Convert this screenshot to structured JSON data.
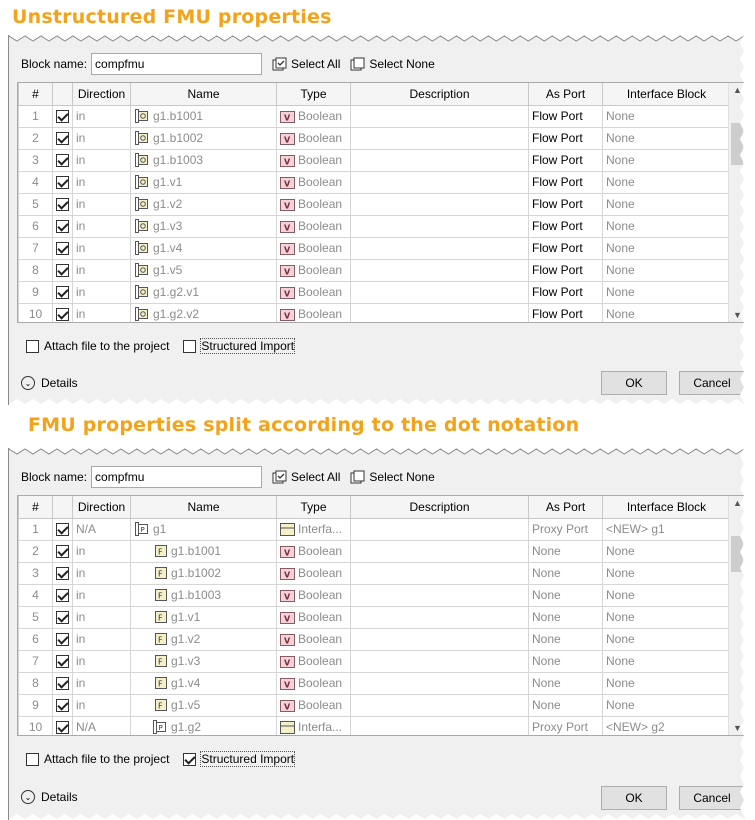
{
  "headings": {
    "first": "Unstructured FMU properties",
    "second": "FMU properties split according to the dot notation"
  },
  "common": {
    "block_name_label": "Block name:",
    "select_all": "Select All",
    "select_none": "Select None",
    "attach_label": "Attach file to the project",
    "structured_label": "Structured Import",
    "details_label": "Details",
    "ok_label": "OK",
    "cancel_label": "Cancel",
    "columns": [
      "#",
      "",
      "Direction",
      "Name",
      "Type",
      "Description",
      "As Port",
      "Interface Block"
    ]
  },
  "dialog1": {
    "block_name": "compfmu",
    "structured_checked": false,
    "rows": [
      {
        "num": "1",
        "direction": "in",
        "name": "g1.b1001",
        "type": "Boolean",
        "as_port": "Flow Port",
        "iface": "None"
      },
      {
        "num": "2",
        "direction": "in",
        "name": "g1.b1002",
        "type": "Boolean",
        "as_port": "Flow Port",
        "iface": "None"
      },
      {
        "num": "3",
        "direction": "in",
        "name": "g1.b1003",
        "type": "Boolean",
        "as_port": "Flow Port",
        "iface": "None"
      },
      {
        "num": "4",
        "direction": "in",
        "name": "g1.v1",
        "type": "Boolean",
        "as_port": "Flow Port",
        "iface": "None"
      },
      {
        "num": "5",
        "direction": "in",
        "name": "g1.v2",
        "type": "Boolean",
        "as_port": "Flow Port",
        "iface": "None"
      },
      {
        "num": "6",
        "direction": "in",
        "name": "g1.v3",
        "type": "Boolean",
        "as_port": "Flow Port",
        "iface": "None"
      },
      {
        "num": "7",
        "direction": "in",
        "name": "g1.v4",
        "type": "Boolean",
        "as_port": "Flow Port",
        "iface": "None"
      },
      {
        "num": "8",
        "direction": "in",
        "name": "g1.v5",
        "type": "Boolean",
        "as_port": "Flow Port",
        "iface": "None"
      },
      {
        "num": "9",
        "direction": "in",
        "name": "g1.g2.v1",
        "type": "Boolean",
        "as_port": "Flow Port",
        "iface": "None"
      },
      {
        "num": "10",
        "direction": "in",
        "name": "g1.g2.v2",
        "type": "Boolean",
        "as_port": "Flow Port",
        "iface": "None"
      }
    ]
  },
  "dialog2": {
    "block_name": "compfmu",
    "structured_checked": true,
    "rows": [
      {
        "num": "1",
        "direction": "N/A",
        "name": "g1",
        "type": "Interfa...",
        "as_port": "Proxy Port",
        "iface": "<NEW> g1",
        "kind": "group",
        "indent": 0
      },
      {
        "num": "2",
        "direction": "in",
        "name": "g1.b1001",
        "type": "Boolean",
        "as_port": "None",
        "iface": "None",
        "kind": "flow",
        "indent": 1
      },
      {
        "num": "3",
        "direction": "in",
        "name": "g1.b1002",
        "type": "Boolean",
        "as_port": "None",
        "iface": "None",
        "kind": "flow",
        "indent": 1
      },
      {
        "num": "4",
        "direction": "in",
        "name": "g1.b1003",
        "type": "Boolean",
        "as_port": "None",
        "iface": "None",
        "kind": "flow",
        "indent": 1
      },
      {
        "num": "5",
        "direction": "in",
        "name": "g1.v1",
        "type": "Boolean",
        "as_port": "None",
        "iface": "None",
        "kind": "flow",
        "indent": 1
      },
      {
        "num": "6",
        "direction": "in",
        "name": "g1.v2",
        "type": "Boolean",
        "as_port": "None",
        "iface": "None",
        "kind": "flow",
        "indent": 1
      },
      {
        "num": "7",
        "direction": "in",
        "name": "g1.v3",
        "type": "Boolean",
        "as_port": "None",
        "iface": "None",
        "kind": "flow",
        "indent": 1
      },
      {
        "num": "8",
        "direction": "in",
        "name": "g1.v4",
        "type": "Boolean",
        "as_port": "None",
        "iface": "None",
        "kind": "flow",
        "indent": 1
      },
      {
        "num": "9",
        "direction": "in",
        "name": "g1.v5",
        "type": "Boolean",
        "as_port": "None",
        "iface": "None",
        "kind": "flow",
        "indent": 1
      },
      {
        "num": "10",
        "direction": "N/A",
        "name": "g1.g2",
        "type": "Interfa...",
        "as_port": "Proxy Port",
        "iface": "<NEW> g2",
        "kind": "group",
        "indent": 1
      }
    ]
  }
}
